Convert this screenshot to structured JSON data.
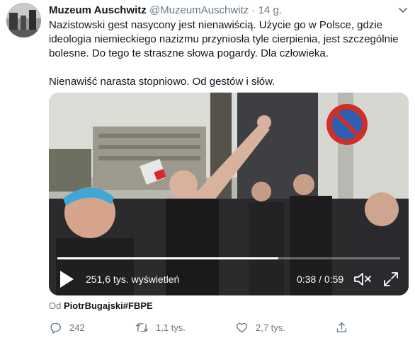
{
  "tweet": {
    "author_name": "Muzeum Auschwitz",
    "author_handle": "@MuzeumAuschwitz",
    "separator": "·",
    "time": "14 g.",
    "paragraph1": "Nazistowski gest nasycony jest nienawiścią. Użycie go w Polsce, gdzie ideologia niemieckiego nazizmu przyniosła tyle cierpienia, jest szczególnie bolesne. Do tego te straszne słowa pogardy. Dla człowieka.",
    "paragraph2": "Nienawiść narasta stopniowo. Od gestów i słów."
  },
  "video": {
    "views": "251,6 tys. wyświetleń",
    "timecode": "0:38 / 0:59",
    "progress_fraction": 0.644,
    "icons": {
      "play": "play-icon",
      "mute": "volume-muted-icon",
      "fullscreen": "fullscreen-icon"
    }
  },
  "attribution": {
    "prefix": "Od",
    "source": "PiotrBugajski#FBPE"
  },
  "actions": {
    "reply_count": "242",
    "retweet_count": "1,1 tys.",
    "like_count": "2,7 tys.",
    "icons": {
      "reply": "reply-icon",
      "retweet": "retweet-icon",
      "like": "heart-icon",
      "share": "share-icon"
    }
  },
  "colors": {
    "text": "#14171a",
    "secondary": "#657786",
    "link": "#1da1f2"
  }
}
